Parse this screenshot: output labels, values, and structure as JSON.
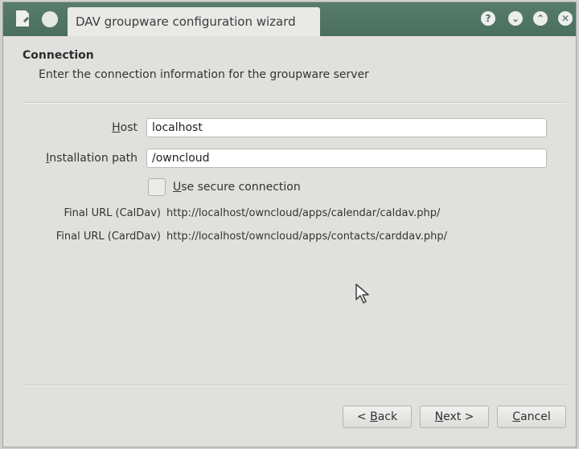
{
  "window": {
    "title": "DAV groupware configuration wizard",
    "icons": {
      "app": "document-icon",
      "menu": "window-menu-icon",
      "help": "help-icon",
      "minimize": "minimize-icon",
      "maximize": "maximize-icon",
      "close": "close-icon"
    },
    "help_glyph": "?",
    "min_glyph": "⌄",
    "max_glyph": "⌃",
    "close_glyph": "✕",
    "titlebar_color": "#4f7562"
  },
  "page": {
    "title": "Connection",
    "subtitle": "Enter the connection information for the groupware server"
  },
  "form": {
    "host": {
      "label_mnemonic": "H",
      "label_rest": "ost",
      "value": "localhost"
    },
    "path": {
      "label_mnemonic": "I",
      "label_rest": "nstallation path",
      "value": "/owncloud"
    },
    "secure": {
      "label_mnemonic": "U",
      "label_rest": "se secure connection",
      "checked": false
    }
  },
  "urls": {
    "caldav_label": "Final URL (CalDav)",
    "caldav_value": "http://localhost/owncloud/apps/calendar/caldav.php/",
    "carddav_label": "Final URL (CardDav)",
    "carddav_value": "http://localhost/owncloud/apps/contacts/carddav.php/"
  },
  "buttons": {
    "back": {
      "prefix": "< ",
      "mnemonic": "B",
      "rest": "ack"
    },
    "next": {
      "mnemonic": "N",
      "rest": "ext >"
    },
    "cancel": {
      "mnemonic": "C",
      "rest": "ancel"
    }
  }
}
